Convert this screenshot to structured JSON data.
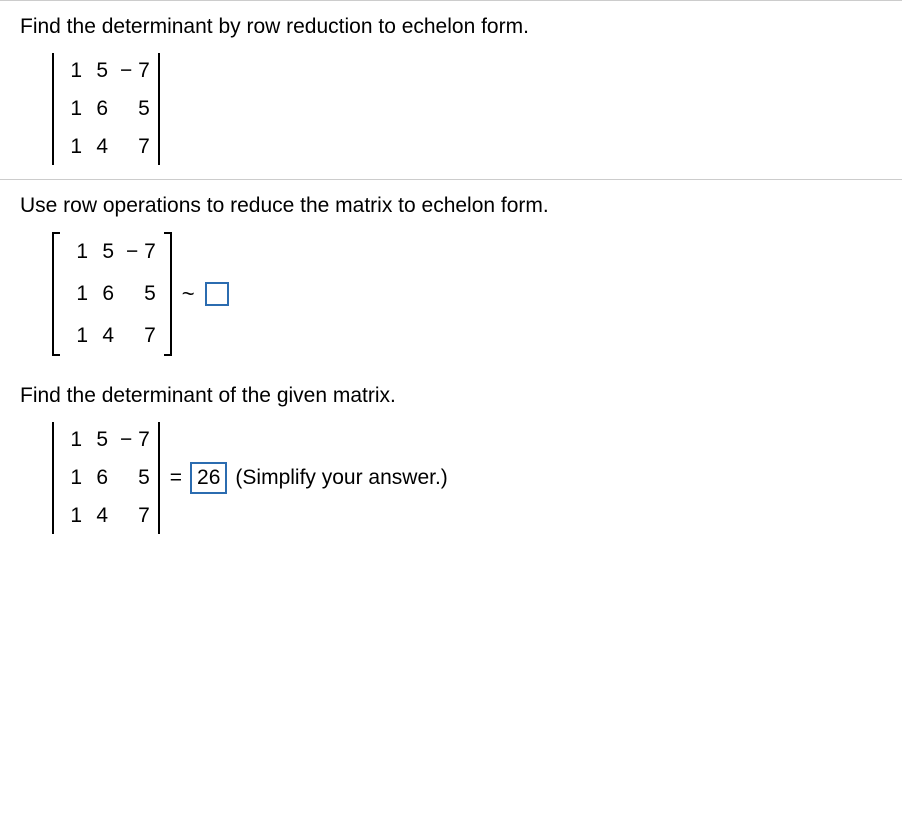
{
  "problem": {
    "title": "Find the determinant by row reduction to echelon form.",
    "matrix1": {
      "r1c1": "1",
      "r1c2": "5",
      "r1c3": "− 7",
      "r2c1": "1",
      "r2c2": "6",
      "r2c3": "5",
      "r3c1": "1",
      "r3c2": "4",
      "r3c3": "7"
    }
  },
  "step1": {
    "title": "Use row operations to reduce the matrix to echelon form.",
    "matrix": {
      "r1c1": "1",
      "r1c2": "5",
      "r1c3": "− 7",
      "r2c1": "1",
      "r2c2": "6",
      "r2c3": "5",
      "r3c1": "1",
      "r3c2": "4",
      "r3c3": "7"
    },
    "tilde": "~"
  },
  "step2": {
    "title": "Find the determinant of the given matrix.",
    "matrix": {
      "r1c1": "1",
      "r1c2": "5",
      "r1c3": "− 7",
      "r2c1": "1",
      "r2c2": "6",
      "r2c3": "5",
      "r3c1": "1",
      "r3c2": "4",
      "r3c3": "7"
    },
    "equals": "=",
    "answer": "26",
    "hint": "(Simplify your answer.)"
  }
}
